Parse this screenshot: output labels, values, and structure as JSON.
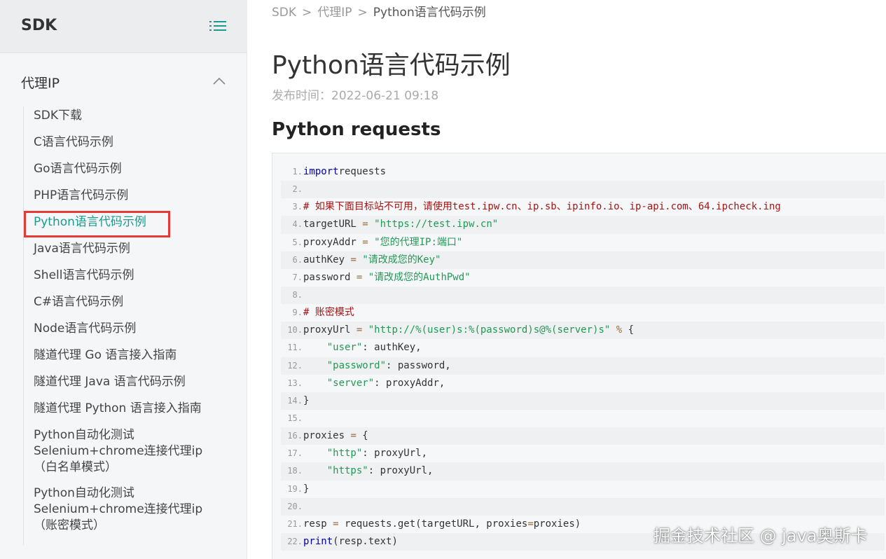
{
  "sidebar": {
    "title": "SDK",
    "group_title": "代理IP",
    "items": [
      {
        "label": "SDK下载"
      },
      {
        "label": "C语言代码示例"
      },
      {
        "label": "Go语言代码示例"
      },
      {
        "label": "PHP语言代码示例"
      },
      {
        "label": "Python语言代码示例",
        "active": true
      },
      {
        "label": "Java语言代码示例"
      },
      {
        "label": "Shell语言代码示例"
      },
      {
        "label": "C#语言代码示例"
      },
      {
        "label": "Node语言代码示例"
      },
      {
        "label": "隧道代理 Go 语言接入指南"
      },
      {
        "label": "隧道代理 Java 语言代码示例"
      },
      {
        "label": "隧道代理 Python 语言接入指南"
      },
      {
        "label": "Python自动化测试Selenium+chrome连接代理ip（白名单模式）",
        "lines": [
          "Python自动化测试",
          "Selenium+chrome连接代理ip",
          "（白名单模式）"
        ]
      },
      {
        "label": "Python自动化测试Selenium+chrome连接代理ip（账密模式）",
        "lines": [
          "Python自动化测试",
          "Selenium+chrome连接代理ip",
          "（账密模式）"
        ]
      }
    ]
  },
  "breadcrumb": {
    "items": [
      "SDK",
      "代理IP",
      "Python语言代码示例"
    ],
    "separator": ">"
  },
  "article": {
    "title": "Python语言代码示例",
    "publish_time": "发布时间：2022-06-21 09:18",
    "section_title": "Python requests"
  },
  "code": {
    "lines": [
      {
        "n": "1.",
        "tokens": [
          [
            "kw",
            "import"
          ],
          [
            "",
            "requests"
          ]
        ]
      },
      {
        "n": "2.",
        "tokens": []
      },
      {
        "n": "3.",
        "tokens": [
          [
            "cmt",
            "# 如果下面目标站不可用，请使用test.ipw.cn、ip.sb、ipinfo.io、ip-api.com、64.ipcheck.ing"
          ]
        ]
      },
      {
        "n": "4.",
        "tokens": [
          [
            "",
            "targetURL "
          ],
          [
            "op",
            "="
          ],
          [
            "",
            " "
          ],
          [
            "str",
            "\"https://test.ipw.cn\""
          ]
        ]
      },
      {
        "n": "5.",
        "tokens": [
          [
            "",
            "proxyAddr "
          ],
          [
            "op",
            "="
          ],
          [
            "",
            " "
          ],
          [
            "str",
            "\"您的代理IP:端口\""
          ]
        ]
      },
      {
        "n": "6.",
        "tokens": [
          [
            "",
            "authKey "
          ],
          [
            "op",
            "="
          ],
          [
            "",
            " "
          ],
          [
            "str",
            "\"请改成您的Key\""
          ]
        ]
      },
      {
        "n": "7.",
        "tokens": [
          [
            "",
            "password "
          ],
          [
            "op",
            "="
          ],
          [
            "",
            " "
          ],
          [
            "str",
            "\"请改成您的AuthPwd\""
          ]
        ]
      },
      {
        "n": "8.",
        "tokens": []
      },
      {
        "n": "9.",
        "tokens": [
          [
            "cmt",
            "# 账密模式"
          ]
        ]
      },
      {
        "n": "10.",
        "tokens": [
          [
            "",
            "proxyUrl "
          ],
          [
            "op",
            "="
          ],
          [
            "",
            " "
          ],
          [
            "str",
            "\"http://%(user)s:%(password)s@%(server)s\""
          ],
          [
            "",
            " "
          ],
          [
            "op",
            "%"
          ],
          [
            "",
            " {"
          ]
        ]
      },
      {
        "n": "11.",
        "tokens": [
          [
            "",
            "    "
          ],
          [
            "str",
            "\"user\""
          ],
          [
            "",
            ": authKey,"
          ]
        ]
      },
      {
        "n": "12.",
        "tokens": [
          [
            "",
            "    "
          ],
          [
            "str",
            "\"password\""
          ],
          [
            "",
            ": password,"
          ]
        ]
      },
      {
        "n": "13.",
        "tokens": [
          [
            "",
            "    "
          ],
          [
            "str",
            "\"server\""
          ],
          [
            "",
            ": proxyAddr,"
          ]
        ]
      },
      {
        "n": "14.",
        "tokens": [
          [
            "",
            "}"
          ]
        ]
      },
      {
        "n": "15.",
        "tokens": []
      },
      {
        "n": "16.",
        "tokens": [
          [
            "",
            "proxies "
          ],
          [
            "op",
            "="
          ],
          [
            "",
            " {"
          ]
        ]
      },
      {
        "n": "17.",
        "tokens": [
          [
            "",
            "    "
          ],
          [
            "str",
            "\"http\""
          ],
          [
            "",
            ": proxyUrl,"
          ]
        ]
      },
      {
        "n": "18.",
        "tokens": [
          [
            "",
            "    "
          ],
          [
            "str",
            "\"https\""
          ],
          [
            "",
            ": proxyUrl,"
          ]
        ]
      },
      {
        "n": "19.",
        "tokens": [
          [
            "",
            "}"
          ]
        ]
      },
      {
        "n": "20.",
        "tokens": []
      },
      {
        "n": "21.",
        "tokens": [
          [
            "",
            "resp "
          ],
          [
            "op",
            "="
          ],
          [
            "",
            " requests.get(targetURL, proxies"
          ],
          [
            "op",
            "="
          ],
          [
            "",
            "proxies)"
          ]
        ]
      },
      {
        "n": "22.",
        "tokens": [
          [
            "fn",
            "print"
          ],
          [
            "",
            "(resp.text)"
          ]
        ]
      }
    ]
  },
  "watermark": "掘金技术社区 @ java奥斯卡",
  "colors": {
    "accent": "#1a9b8e",
    "highlight_border": "#e53935"
  }
}
